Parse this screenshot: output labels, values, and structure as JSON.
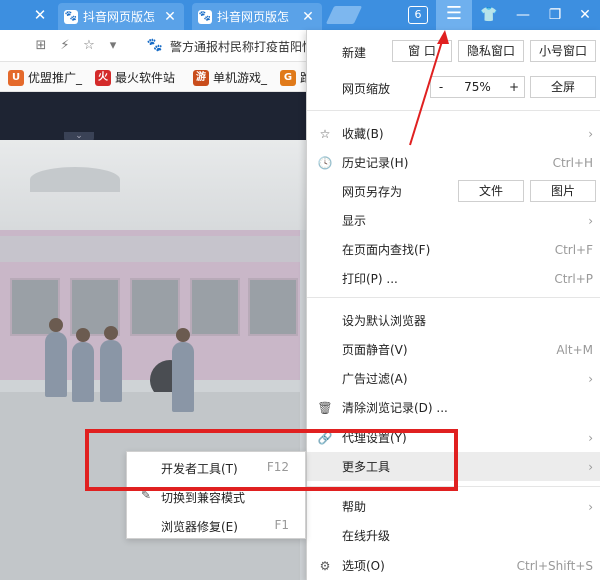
{
  "tabs": [
    {
      "title": "抖音网页版怎"
    },
    {
      "title": "抖音网页版怎"
    }
  ],
  "window": {
    "tab_count": "6",
    "menu_glyph": "☰",
    "skin_glyph": "👕",
    "minimize_glyph": "—",
    "restore_glyph": "❐",
    "close_glyph": "✕"
  },
  "address": {
    "text": "警方通报村民称打疫苗阳性"
  },
  "bookmarks": [
    {
      "label": "优盟推广_",
      "color": "#e46a2c",
      "icon": "fire-icon"
    },
    {
      "label": "最火软件站",
      "color": "#d42b2b",
      "icon": "flame-icon"
    },
    {
      "label": "单机游戏_",
      "color": "#c94d1c",
      "icon": "game-icon"
    },
    {
      "label": "跑",
      "color": "#e07a1a",
      "icon": "g-icon"
    }
  ],
  "menu": {
    "new_label": "新建",
    "window_btn": "窗 口",
    "private_btn": "隐私窗口",
    "small_btn": "小号窗口",
    "zoom_label": "网页缩放",
    "zoom_minus": "-",
    "zoom_value": "75%",
    "zoom_plus": "+",
    "fullscreen_btn": "全屏",
    "items": [
      {
        "label": "收藏(B)",
        "shortcut": "",
        "arrow": "›",
        "icon": "☆"
      },
      {
        "label": "历史记录(H)",
        "shortcut": "Ctrl+H",
        "arrow": "",
        "icon": "🕓"
      },
      {
        "label": "网页另存为",
        "shortcut": "",
        "arrow": "",
        "icon": ""
      },
      {
        "label": "显示",
        "shortcut": "",
        "arrow": "›",
        "icon": ""
      },
      {
        "label": "在页面内查找(F)",
        "shortcut": "Ctrl+F",
        "arrow": "",
        "icon": ""
      },
      {
        "label": "打印(P) ...",
        "shortcut": "Ctrl+P",
        "arrow": "",
        "icon": ""
      },
      {
        "label": "设为默认浏览器",
        "shortcut": "",
        "arrow": "",
        "icon": ""
      },
      {
        "label": "页面静音(V)",
        "shortcut": "Alt+M",
        "arrow": "",
        "icon": ""
      },
      {
        "label": "广告过滤(A)",
        "shortcut": "",
        "arrow": "›",
        "icon": ""
      },
      {
        "label": "清除浏览记录(D) ...",
        "shortcut": "",
        "arrow": "",
        "icon": "🗑"
      },
      {
        "label": "代理设置(Y)",
        "shortcut": "",
        "arrow": "›",
        "icon": "🔗"
      },
      {
        "label": "更多工具",
        "shortcut": "",
        "arrow": "›",
        "icon": ""
      },
      {
        "label": "帮助",
        "shortcut": "",
        "arrow": "›",
        "icon": ""
      },
      {
        "label": "在线升级",
        "shortcut": "",
        "arrow": "",
        "icon": ""
      },
      {
        "label": "选项(O)",
        "shortcut": "Ctrl+Shift+S",
        "arrow": "",
        "icon": "⚙"
      }
    ],
    "save_file_btn": "文件",
    "save_image_btn": "图片"
  },
  "submenu": {
    "items": [
      {
        "label": "开发者工具(T)",
        "shortcut": "F12"
      },
      {
        "label": "切换到兼容模式",
        "shortcut": ""
      },
      {
        "label": "浏览器修复(E)",
        "shortcut": "F1"
      }
    ]
  },
  "colors": {
    "tabbar": "#3d8fe0",
    "highlight_box": "#e02020"
  }
}
